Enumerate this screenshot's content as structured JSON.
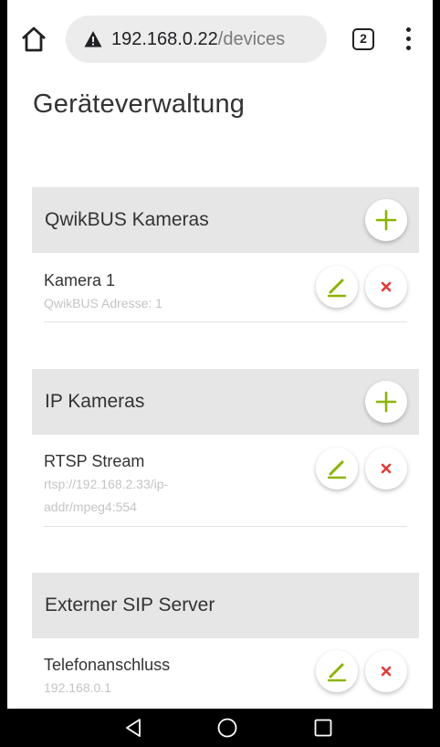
{
  "browser": {
    "url_host": "192.168.0.22",
    "url_path": "/devices",
    "tab_count": "2"
  },
  "page": {
    "title": "Geräteverwaltung"
  },
  "sections": [
    {
      "title": "QwikBUS Kameras",
      "items": [
        {
          "name": "Kamera 1",
          "subtitle_lines": [
            "QwikBUS Adresse: 1"
          ]
        }
      ]
    },
    {
      "title": "IP Kameras",
      "items": [
        {
          "name": "RTSP Stream",
          "subtitle_lines": [
            "rtsp://192.168.2.33/ip-",
            "addr/mpeg4:554"
          ]
        }
      ]
    },
    {
      "title": "Externer SIP Server",
      "items": [
        {
          "name": "Telefonanschluss",
          "subtitle_lines": [
            "192.168.0.1"
          ]
        }
      ]
    }
  ],
  "colors": {
    "accent_green": "#8bb400",
    "delete_red": "#e53935",
    "section_bg": "#e6e6e6"
  },
  "icons": {
    "home": "home-icon",
    "warning": "warning-icon",
    "menu": "more-vert-icon",
    "add": "plus-icon",
    "edit": "pencil-icon",
    "delete": "close-icon",
    "nav_back": "triangle-back-icon",
    "nav_home": "circle-home-icon",
    "nav_recent": "square-recents-icon"
  }
}
